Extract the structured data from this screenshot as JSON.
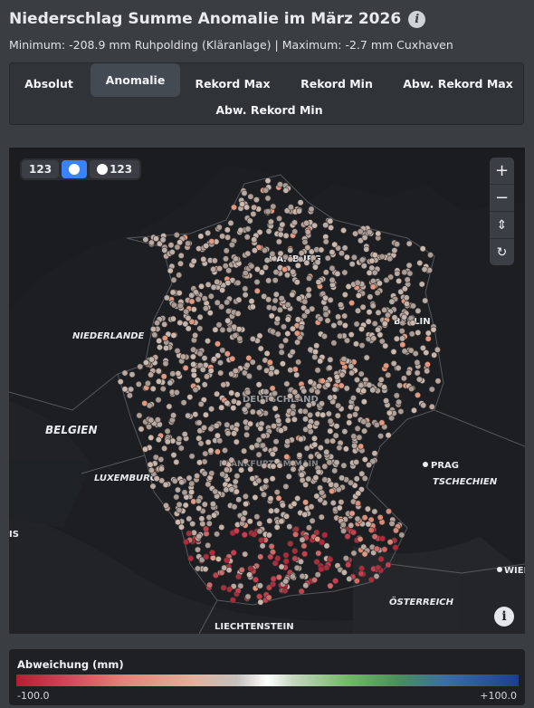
{
  "header": {
    "title": "Niederschlag Summe Anomalie im März 2026",
    "subtitle": "Minimum: -208.9 mm Ruhpolding (Kläranlage) | Maximum: -2.7 mm Cuxhaven"
  },
  "tabs": [
    {
      "label": "Absolut",
      "active": false
    },
    {
      "label": "Anomalie",
      "active": true
    },
    {
      "label": "Rekord Max",
      "active": false
    },
    {
      "label": "Rekord Min",
      "active": false
    },
    {
      "label": "Abw. Rekord Max",
      "active": false
    },
    {
      "label": "Abw. Rekord Min",
      "active": false
    }
  ],
  "map": {
    "display_toggle": {
      "values_label": "123",
      "dots_and_values_label": "123",
      "selected": "dots"
    },
    "zoom_in": "+",
    "zoom_out": "−",
    "compass": "⇕",
    "reset": "↻",
    "attribution": "i",
    "labels": {
      "hamburg": "HAMBURG",
      "berlin": "BERLIN",
      "niederlande": "NIEDERLANDE",
      "belgien": "BELGIEN",
      "luxemburg": "LUXEMBURG",
      "prag": "PRAG",
      "tschechien": "TSCHECHIEN",
      "wien": "WIEN",
      "oesterreich": "ÖSTERREICH",
      "liechtenstein": "LIECHTENSTEIN",
      "left_edge": "IS",
      "hidden_center": "DEUTSCHLAND",
      "hidden_sw": "FRANKFURT AM MAIN"
    }
  },
  "legend": {
    "title": "Abweichung (mm)",
    "min_label": "-100.0",
    "max_label": "+100.0",
    "colors": [
      "#b91c2f",
      "#e4857a",
      "#c5c1bd",
      "#ffffff",
      "#74b86a",
      "#1e3e8e"
    ]
  }
}
